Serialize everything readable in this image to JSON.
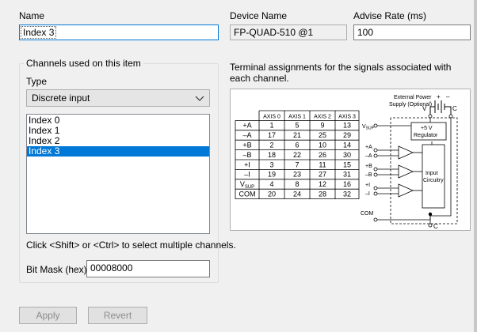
{
  "fields": {
    "name": {
      "label": "Name",
      "value": "Index 3"
    },
    "device_name": {
      "label": "Device Name",
      "value": "FP-QUAD-510 @1"
    },
    "advise_rate": {
      "label": "Advise Rate (ms)",
      "value": "100"
    }
  },
  "channels_group": {
    "caption": "Channels used on this item",
    "type_label": "Type",
    "type_value": "Discrete input",
    "channels": [
      "Index 0",
      "Index 1",
      "Index 2",
      "Index 3"
    ],
    "selected_channel": "Index 3",
    "hint": "Click <Shift> or <Ctrl> to select multiple channels.",
    "bitmask_label": "Bit Mask (hex)",
    "bitmask_value": "00008000"
  },
  "terminal_info": {
    "text": "Terminal assignments for the signals associated with each channel.",
    "table": {
      "headers": [
        "",
        "AXIS 0",
        "AXIS 1",
        "AXIS 2",
        "AXIS 3"
      ],
      "rows": [
        [
          "+A",
          "1",
          "5",
          "9",
          "13"
        ],
        [
          "–A",
          "17",
          "21",
          "25",
          "29"
        ],
        [
          "+B",
          "2",
          "6",
          "10",
          "14"
        ],
        [
          "–B",
          "18",
          "22",
          "26",
          "30"
        ],
        [
          "+I",
          "3",
          "7",
          "11",
          "15"
        ],
        [
          "–I",
          "19",
          "23",
          "27",
          "31"
        ],
        [
          "VSUP",
          "4",
          "8",
          "12",
          "16"
        ],
        [
          "COM",
          "20",
          "24",
          "28",
          "32"
        ]
      ]
    },
    "circuit": {
      "supply_label_1": "External Power",
      "supply_label_2": "Supply (Optional)",
      "v_label": "V",
      "c_label": "C",
      "c_bottom_label": "C",
      "vsup_label": "VSUP",
      "regulator_1": "+5 V",
      "regulator_2": "Regulator",
      "input_1": "Input",
      "input_2": "Circuitry",
      "plus": "+",
      "minus": "–",
      "pin_labels": [
        "+A",
        "–A",
        "+B",
        "–B",
        "+I",
        "–I",
        "COM"
      ]
    }
  },
  "buttons": {
    "apply": "Apply",
    "revert": "Revert"
  }
}
